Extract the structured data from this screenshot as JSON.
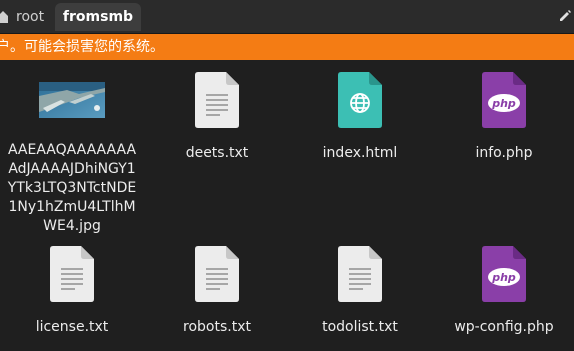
{
  "tabs": [
    {
      "label": "root",
      "icon": "home-icon"
    },
    {
      "label": "fromsmb",
      "active": true
    }
  ],
  "toolbar": {
    "edit_icon": "pencil-icon"
  },
  "banner": {
    "text": "户。可能会损害您的系统。",
    "color": "#f47c14"
  },
  "files": [
    {
      "name": "AAEAAQAAAAAAAAdJAAAAJDhiNGY1YTk3LTQ3NTctNDE1Ny1hZmU4LTlhMWE4.jpg",
      "type": "image"
    },
    {
      "name": "deets.txt",
      "type": "text"
    },
    {
      "name": "index.html",
      "type": "html"
    },
    {
      "name": "info.php",
      "type": "php"
    },
    {
      "name": "license.txt",
      "type": "text"
    },
    {
      "name": "robots.txt",
      "type": "text"
    },
    {
      "name": "todolist.txt",
      "type": "text"
    },
    {
      "name": "wp-config.php",
      "type": "php"
    }
  ],
  "icon_labels": {
    "php": "php"
  },
  "colors": {
    "html": "#3cbfb4",
    "php": "#8a3fa8",
    "accent": "#f47c14"
  }
}
